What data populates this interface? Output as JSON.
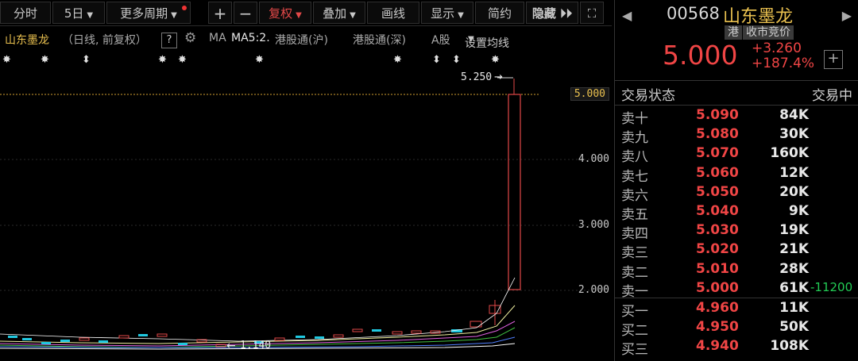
{
  "toolbar": {
    "intraday": "分时",
    "days": "5日",
    "more_period": "更多周期",
    "plus": "+",
    "minus": "−",
    "adjust": "复权",
    "overlay": "叠加",
    "draw": "画线",
    "display": "显示",
    "simple": "简约",
    "hide": "隐藏 ⏵⏵",
    "fullscreen": "⛶"
  },
  "infobar": {
    "stock_name": "山东墨龙",
    "mode": "（日线, 前复权）",
    "help": "?",
    "ma_label": "MA",
    "ma5": "MA5:2.",
    "hk_connect_sh": "港股通(沪)",
    "hk_connect_sz": "港股通(深)",
    "a_share": "A股",
    "set_ma": "设置均线"
  },
  "chart": {
    "high_label": "5.250",
    "low_label": "1.140",
    "current_price_tag": "5.000",
    "axis_labels": [
      "4.000",
      "3.000",
      "2.000"
    ],
    "up_color": "#e24848",
    "down_color": "#20c8e0"
  },
  "quote": {
    "code": "00568",
    "name": "山东墨龙",
    "badge_hk": "港",
    "badge_auction": "收市竞价",
    "price": "5.000",
    "change": "+3.260",
    "change_pct": "+187.4%",
    "plus": "+",
    "status_label": "交易状态",
    "status_value": "交易中"
  },
  "sells": [
    {
      "label": "卖十",
      "price": "5.090",
      "vol": "84K"
    },
    {
      "label": "卖九",
      "price": "5.080",
      "vol": "30K"
    },
    {
      "label": "卖八",
      "price": "5.070",
      "vol": "160K"
    },
    {
      "label": "卖七",
      "price": "5.060",
      "vol": "12K"
    },
    {
      "label": "卖六",
      "price": "5.050",
      "vol": "20K"
    },
    {
      "label": "卖五",
      "price": "5.040",
      "vol": "9K"
    },
    {
      "label": "卖四",
      "price": "5.030",
      "vol": "19K"
    },
    {
      "label": "卖三",
      "price": "5.020",
      "vol": "21K"
    },
    {
      "label": "卖二",
      "price": "5.010",
      "vol": "28K"
    },
    {
      "label": "卖一",
      "price": "5.000",
      "vol": "61K",
      "extra": "-11200"
    }
  ],
  "buys": [
    {
      "label": "买一",
      "price": "4.960",
      "vol": "11K"
    },
    {
      "label": "买二",
      "price": "4.950",
      "vol": "50K"
    },
    {
      "label": "买三",
      "price": "4.940",
      "vol": "108K"
    }
  ]
}
